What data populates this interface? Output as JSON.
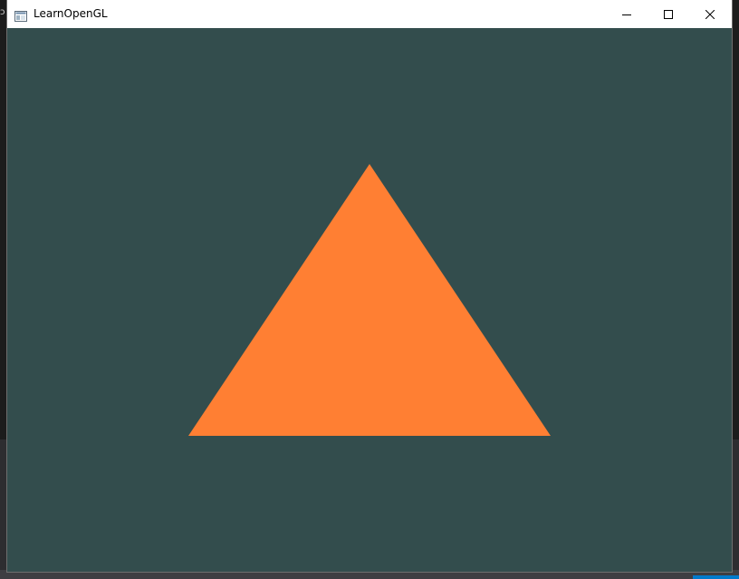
{
  "window": {
    "title": "LearnOpenGL",
    "controls": [
      "minimize",
      "maximize",
      "close"
    ],
    "icons": {
      "app": "app-window-icon",
      "minimize": "minimize-icon",
      "maximize": "maximize-icon",
      "close": "close-icon"
    }
  },
  "viewport": {
    "clear_color": "#334d4d",
    "shape": "triangle",
    "triangle_color": "#ff7f33"
  },
  "background": {
    "edge_text": "ɔ"
  }
}
